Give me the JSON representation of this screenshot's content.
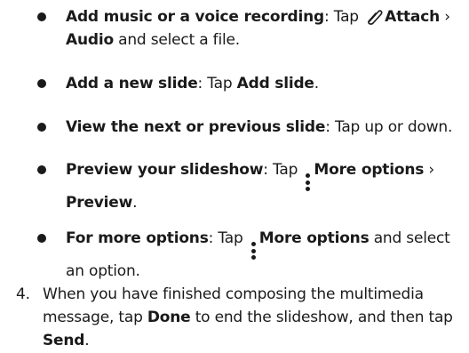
{
  "bullets": [
    {
      "title": "Add music or a voice recording",
      "sep": ": ",
      "tap": "Tap ",
      "icon": "paperclip-icon",
      "target": "Attach",
      "chev": " › ",
      "target2": "Audio",
      "rest": " and select a file."
    },
    {
      "title": "Add a new slide",
      "sep": ": ",
      "tap": "Tap ",
      "target": "Add slide",
      "end": "."
    },
    {
      "title": "View the next or previous slide",
      "sep": ": ",
      "rest": "Tap up or down."
    },
    {
      "title": "Preview your slideshow",
      "sep": ": ",
      "tap": "Tap ",
      "icon": "more-options-icon",
      "target": "More options",
      "chev": " › ",
      "target2": "Preview",
      "end": "."
    },
    {
      "title": "For more options",
      "sep": ": ",
      "tap": "Tap ",
      "icon": "more-options-icon",
      "target": "More options",
      "rest": " and select an option."
    }
  ],
  "step": {
    "number": "4.",
    "t1": "When you have finished composing the multimedia message, tap ",
    "done": "Done",
    "t2": " to end the slideshow, and then tap ",
    "send": "Send",
    "t3": "."
  }
}
